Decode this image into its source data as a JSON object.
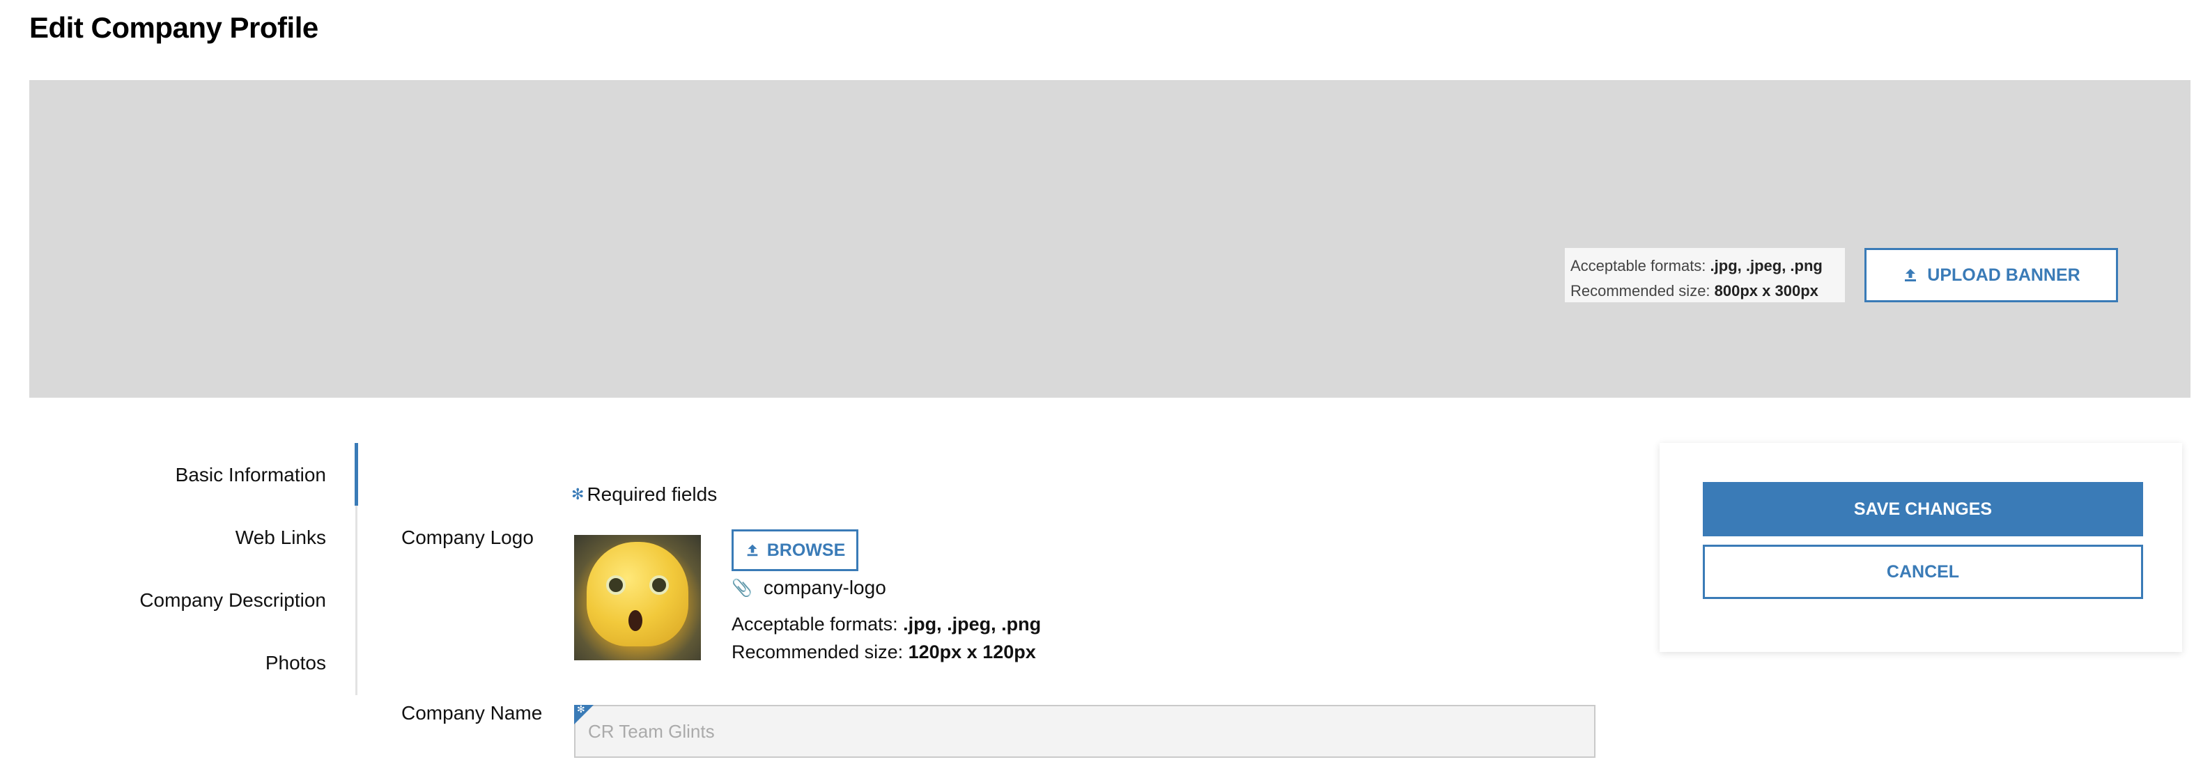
{
  "page": {
    "title": "Edit Company Profile"
  },
  "banner": {
    "formats_label": "Acceptable formats: ",
    "formats_value": ".jpg, .jpeg, .png",
    "size_label": "Recommended size: ",
    "size_value": "800px x 300px",
    "upload_label": "UPLOAD BANNER",
    "upload_icon": "upload-icon"
  },
  "sidebar": {
    "items": [
      {
        "label": "Basic Information",
        "active": true
      },
      {
        "label": "Web Links",
        "active": false
      },
      {
        "label": "Company Description",
        "active": false
      },
      {
        "label": "Photos",
        "active": false
      }
    ]
  },
  "form": {
    "required_note": "Required fields",
    "logo": {
      "label": "Company Logo",
      "browse_label": "BROWSE",
      "file_name": "company-logo",
      "formats_label": "Acceptable formats: ",
      "formats_value": ".jpg, .jpeg, .png",
      "size_label": "Recommended size: ",
      "size_value": "120px x 120px"
    },
    "company_name": {
      "label": "Company Name",
      "placeholder": "CR Team Glints"
    }
  },
  "actions": {
    "save_label": "SAVE CHANGES",
    "cancel_label": "CANCEL"
  },
  "colors": {
    "accent": "#3a7bb7",
    "banner_bg": "#d9d9d9"
  }
}
